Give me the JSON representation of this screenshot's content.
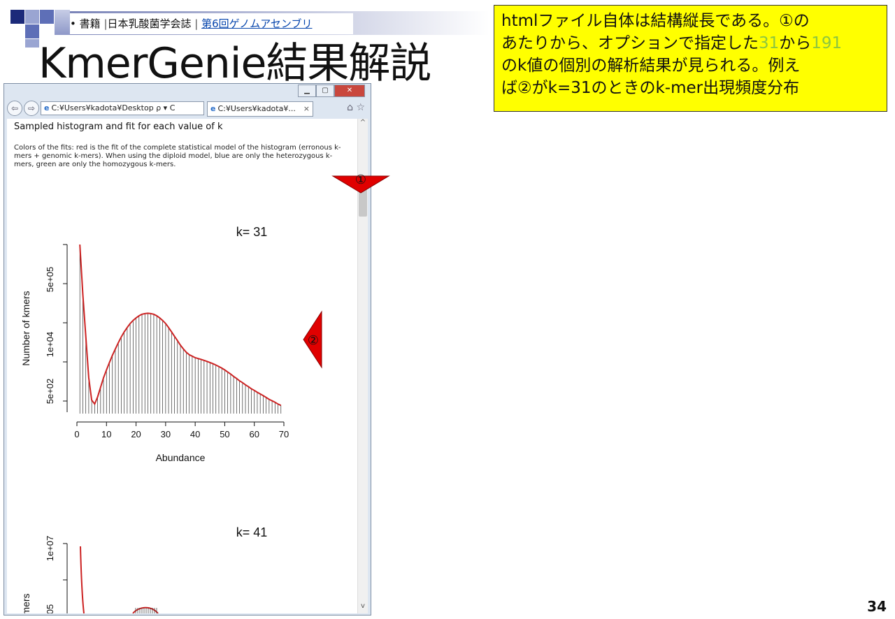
{
  "slide": {
    "breadcrumb": {
      "bullet": "•",
      "item1": "書籍",
      "sep": "|",
      "item2": "日本乳酸菌学会誌",
      "link": "第6回ゲノムアセンブリ"
    },
    "title": "KmerGenie結果解説",
    "note": {
      "line1": "htmlファイル自体は結構縦長である。①の",
      "line2a": "あたりから、オプションで指定した",
      "line2b": "31",
      "line2c": "から",
      "line2d": "191",
      "line3": "のk値の個別の解析結果が見られる。例え",
      "line4": "ば②がk=31のときのk-mer出現頻度分布"
    },
    "page_number": "34",
    "markers": {
      "m1": "①",
      "m2": "②"
    },
    "colors": {
      "note_bg": "#ffff00",
      "highlight_green": "#8dc63f",
      "arrow_red": "#e00000",
      "fit_red": "#cc2222"
    }
  },
  "browser": {
    "address": "C:¥Users¥kadota¥Desktop",
    "address_icons": "ρ ▾ C",
    "tab_title": "C:¥Users¥kadota¥...",
    "tab_close": "×",
    "icons": [
      "back-icon",
      "forward-icon",
      "home-icon",
      "favorites-icon"
    ],
    "content": {
      "heading": "Sampled histogram and fit for each value of k",
      "para": "Colors of the fits: red is the fit of the complete statistical model of the histogram (erronous k-mers + genomic k-mers). When using the diploid model, blue are only the heterozygous k-mers, green are only the homozygous k-mers."
    }
  },
  "chart_data": [
    {
      "type": "bar",
      "title": "k= 31",
      "xlabel": "Abundance",
      "ylabel": "Number of kmers",
      "y_scale": "log",
      "xlim": [
        0,
        70
      ],
      "xticks": [
        "0",
        "10",
        "20",
        "30",
        "40",
        "50",
        "60",
        "70"
      ],
      "yticks": [
        "5e+02",
        "1e+04",
        "5e+05"
      ],
      "fit_color": "#cc2222",
      "x": [
        1,
        2,
        3,
        4,
        5,
        6,
        7,
        8,
        9,
        10,
        11,
        12,
        13,
        14,
        15,
        16,
        17,
        18,
        19,
        20,
        21,
        22,
        23,
        24,
        25,
        26,
        27,
        28,
        29,
        30,
        31,
        32,
        33,
        34,
        35,
        36,
        37,
        38,
        39,
        40,
        41,
        42,
        43,
        44,
        45,
        46,
        47,
        48,
        49,
        50,
        51,
        52,
        53,
        54,
        55,
        56,
        57,
        58,
        59,
        60,
        61,
        62,
        63,
        64,
        65,
        66,
        67,
        68,
        69
      ],
      "values": [
        30000000,
        800000,
        40000,
        2000,
        400,
        300,
        500,
        1000,
        2000,
        3500,
        6000,
        10000,
        16000,
        25000,
        38000,
        55000,
        75000,
        100000,
        125000,
        150000,
        175000,
        195000,
        205000,
        210000,
        205000,
        195000,
        175000,
        150000,
        125000,
        100000,
        75000,
        55000,
        40000,
        29000,
        21000,
        16000,
        12500,
        10500,
        9500,
        8500,
        8000,
        7500,
        7000,
        6500,
        6000,
        5500,
        5000,
        4500,
        4000,
        3500,
        3000,
        2600,
        2200,
        1900,
        1600,
        1400,
        1200,
        1050,
        900,
        800,
        700,
        620,
        550,
        480,
        420,
        380,
        340,
        300,
        270
      ]
    },
    {
      "type": "bar",
      "title": "k= 41",
      "xlabel": "",
      "ylabel": "Number of kmers",
      "y_scale": "log",
      "yticks": [
        "1e+07",
        "05"
      ],
      "ylabel_visible": "mers",
      "fit_color": "#cc2222"
    }
  ]
}
